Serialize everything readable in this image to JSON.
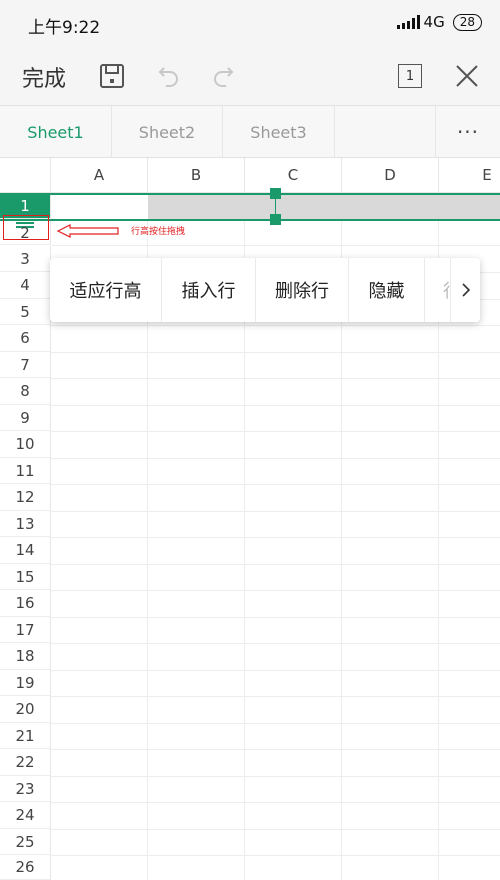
{
  "status_bar": {
    "time": "上午9:22",
    "network": "4G",
    "battery": "28"
  },
  "toolbar": {
    "done_label": "完成",
    "sheet_count": "1"
  },
  "icons": {
    "save": "save-icon",
    "undo": "undo-icon",
    "redo": "redo-icon",
    "close": "close-icon",
    "more": "more-icon"
  },
  "sheets": {
    "tabs": [
      "Sheet1",
      "Sheet2",
      "Sheet3"
    ],
    "active_index": 0,
    "more_label": "···"
  },
  "grid": {
    "columns": [
      "A",
      "B",
      "C",
      "D",
      "E"
    ],
    "rows": [
      "1",
      "2",
      "3",
      "4",
      "5",
      "6",
      "7",
      "8",
      "9",
      "10",
      "11",
      "12",
      "13",
      "14",
      "15",
      "16",
      "17",
      "18",
      "19",
      "20",
      "21",
      "22",
      "23",
      "24",
      "25",
      "26"
    ],
    "selected_row": "1",
    "drag_hint": "行高按住拖拽"
  },
  "context_menu": {
    "items": [
      "适应行高",
      "插入行",
      "删除行",
      "隐藏",
      "行"
    ]
  },
  "colors": {
    "accent": "#1a9a6b",
    "selection": "#d9d9d9",
    "hint": "#e02020"
  }
}
